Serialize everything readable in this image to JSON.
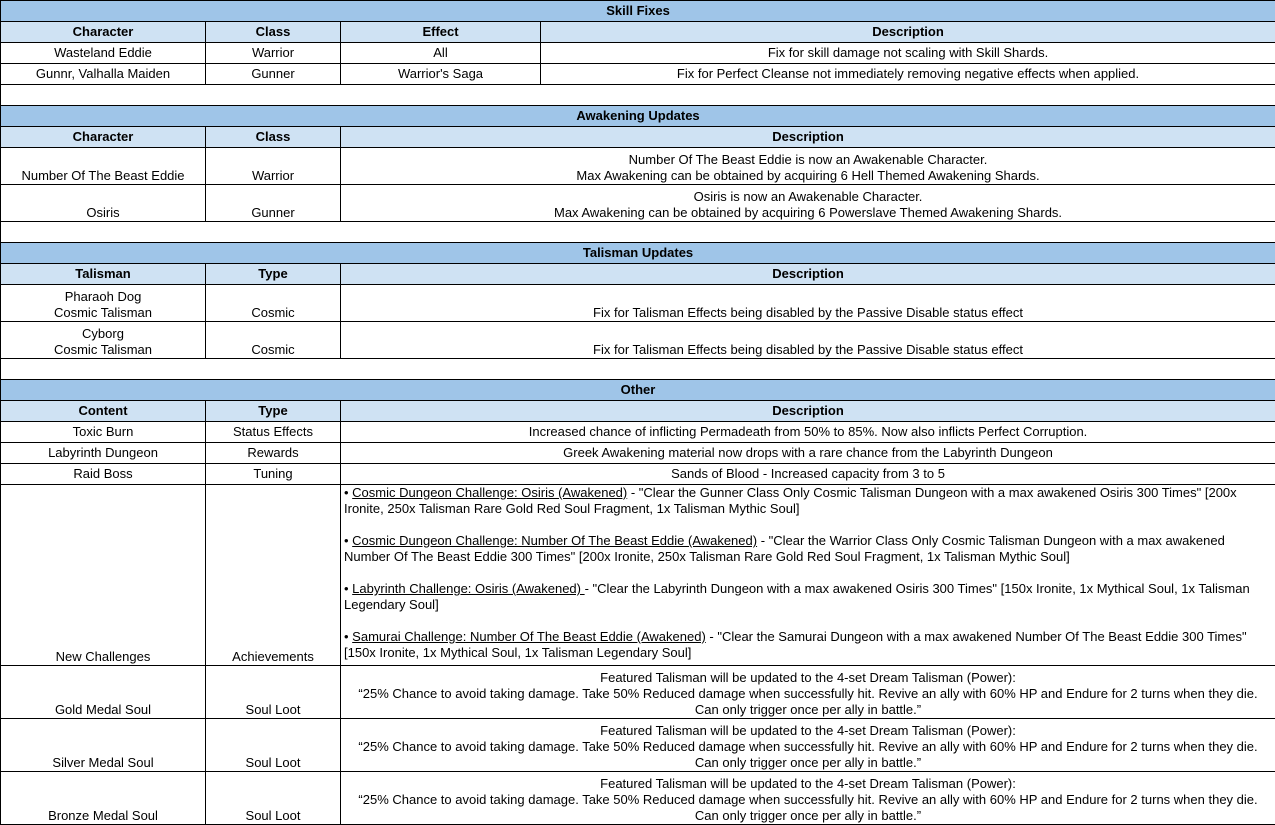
{
  "skill_fixes": {
    "title": "Skill Fixes",
    "headers": [
      "Character",
      "Class",
      "Effect",
      "Description"
    ],
    "rows": [
      {
        "character": "Wasteland Eddie",
        "class": "Warrior",
        "effect": "All",
        "description": "Fix for skill damage not scaling with Skill Shards."
      },
      {
        "character": "Gunnr, Valhalla Maiden",
        "class": "Gunner",
        "effect": "Warrior's Saga",
        "description": "Fix for Perfect Cleanse not immediately removing negative effects when applied."
      }
    ]
  },
  "awakening_updates": {
    "title": "Awakening Updates",
    "headers": [
      "Character",
      "Class",
      "Description"
    ],
    "rows": [
      {
        "character": "Number Of The Beast Eddie",
        "class": "Warrior",
        "line1": "Number Of The Beast Eddie is now an Awakenable Character.",
        "line2": "Max Awakening can be obtained by acquiring 6 Hell Themed Awakening Shards."
      },
      {
        "character": "Osiris",
        "class": "Gunner",
        "line1": "Osiris is now an Awakenable Character.",
        "line2": "Max Awakening can be obtained by acquiring 6 Powerslave Themed Awakening Shards."
      }
    ]
  },
  "talisman_updates": {
    "title": "Talisman Updates",
    "headers": [
      "Talisman",
      "Type",
      "Description"
    ],
    "rows": [
      {
        "name1": "Pharaoh Dog",
        "name2": "Cosmic Talisman",
        "type": "Cosmic",
        "description": "Fix for Talisman Effects being disabled by the Passive Disable status effect"
      },
      {
        "name1": "Cyborg",
        "name2": "Cosmic Talisman",
        "type": "Cosmic",
        "description": "Fix for Talisman Effects being disabled by the Passive Disable status effect"
      }
    ]
  },
  "other": {
    "title": "Other",
    "headers": [
      "Content",
      "Type",
      "Description"
    ],
    "rows": [
      {
        "content": "Toxic Burn",
        "type": "Status Effects",
        "description": "Increased chance of inflicting Permadeath from 50% to 85%. Now also inflicts Perfect Corruption."
      },
      {
        "content": "Labyrinth Dungeon",
        "type": "Rewards",
        "description": "Greek Awakening material now drops with a rare chance from the Labyrinth Dungeon"
      },
      {
        "content": "Raid Boss",
        "type": "Tuning",
        "description": "Sands of Blood - Increased capacity from 3 to 5"
      }
    ],
    "challenges": {
      "content": "New Challenges",
      "type": "Achievements",
      "items": [
        {
          "bullet": "• ",
          "link": "Cosmic Dungeon Challenge: Osiris (Awakened)",
          "text": " - \"Clear the Gunner Class Only Cosmic Talisman Dungeon with a max awakened Osiris 300 Times\" [200x Ironite, 250x Talisman Rare Gold Red Soul Fragment, 1x Talisman Mythic Soul]"
        },
        {
          "bullet": "• ",
          "link": "Cosmic Dungeon Challenge: Number Of The Beast Eddie (Awakened)",
          "text": " - \"Clear the Warrior Class Only Cosmic Talisman Dungeon with a max awakened Number Of The Beast Eddie 300 Times\" [200x Ironite, 250x Talisman Rare Gold Red Soul Fragment, 1x Talisman Mythic Soul]"
        },
        {
          "bullet": "• ",
          "link": "Labyrinth Challenge: Osiris (Awakened) ",
          "text": "- \"Clear the Labyrinth Dungeon with a max awakened Osiris 300 Times\" [150x Ironite, 1x Mythical Soul, 1x Talisman Legendary Soul]"
        },
        {
          "bullet": "• ",
          "link": "Samurai Challenge: Number Of The Beast Eddie (Awakened)",
          "text": " - \"Clear the Samurai Dungeon with a max awakened Number Of The Beast Eddie 300 Times\" [150x Ironite, 1x Mythical Soul, 1x Talisman Legendary Soul]"
        }
      ]
    },
    "souls": [
      {
        "content": "Gold Medal Soul",
        "type": "Soul Loot",
        "line1": "Featured Talisman will be updated to the 4-set Dream Talisman (Power):",
        "line2": "“25% Chance to avoid taking damage. Take 50% Reduced damage when successfully hit. Revive an ally with 60% HP and Endure for 2 turns when they die.",
        "line3": "Can only trigger once per ally in battle.”"
      },
      {
        "content": "Silver Medal Soul",
        "type": "Soul Loot",
        "line1": "Featured Talisman will be updated to the 4-set Dream Talisman (Power):",
        "line2": "“25% Chance to avoid taking damage. Take 50% Reduced damage when successfully hit. Revive an ally with 60% HP and Endure for 2 turns when they die.",
        "line3": "Can only trigger once per ally in battle.”"
      },
      {
        "content": "Bronze Medal Soul",
        "type": "Soul Loot",
        "line1": "Featured Talisman will be updated to the 4-set Dream Talisman (Power):",
        "line2": "“25% Chance to avoid taking damage. Take 50% Reduced damage when successfully hit. Revive an ally with 60% HP and Endure for 2 turns when they die.",
        "line3": "Can only trigger once per ally in battle.”"
      }
    ]
  }
}
